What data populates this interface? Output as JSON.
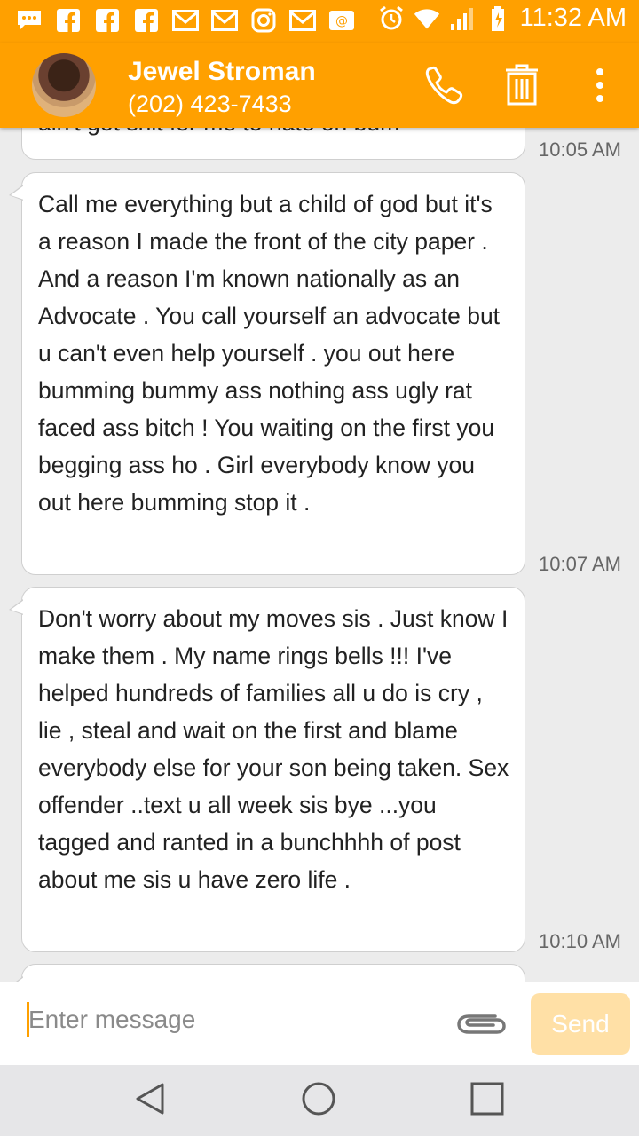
{
  "status_bar": {
    "time": "11:32 AM",
    "notification_icons": [
      "message-icon",
      "facebook-icon",
      "facebook-icon",
      "facebook-icon",
      "gmail-icon",
      "gmail-icon",
      "instagram-icon",
      "gmail-icon",
      "email-icon"
    ],
    "system_icons": [
      "alarm-icon",
      "wifi-icon",
      "signal-icon",
      "battery-icon"
    ]
  },
  "header": {
    "contact_name": "Jewel Stroman",
    "contact_phone": "(202) 423-7433",
    "actions": [
      "phone-icon",
      "trash-icon",
      "more-icon"
    ]
  },
  "messages": [
    {
      "text": "ain't got shit for me to hate on bum",
      "time": "10:05 AM"
    },
    {
      "text": "Call me everything but a child of god but it's a reason I made the front of the city paper . And a reason I'm known nationally as an Advocate . You call yourself an advocate but u can't even help yourself . you out here bumming bummy ass nothing ass ugly rat faced ass bitch ! You waiting on the first you begging ass ho . Girl everybody know you out here bumming stop it .",
      "time": "10:07 AM"
    },
    {
      "text": "Don't worry about my moves sis . Just know I make them . My name rings bells !!! I've helped hundreds of families all u do is cry , lie , steal and wait on the first and blame everybody else for your son being taken. Sex offender ..text u all week sis bye ...you tagged and ranted in a bunchhhh of post about me sis u have zero life .",
      "time": "10:10 AM"
    },
    {
      "text": "",
      "time": ""
    }
  ],
  "compose": {
    "placeholder": "Enter message",
    "value": "",
    "send_label": "Send"
  },
  "nav": [
    "back-icon",
    "home-icon",
    "recents-icon"
  ],
  "colors": {
    "accent": "#ffa000",
    "send_disabled": "#ffe0a6",
    "background": "#ececec"
  }
}
